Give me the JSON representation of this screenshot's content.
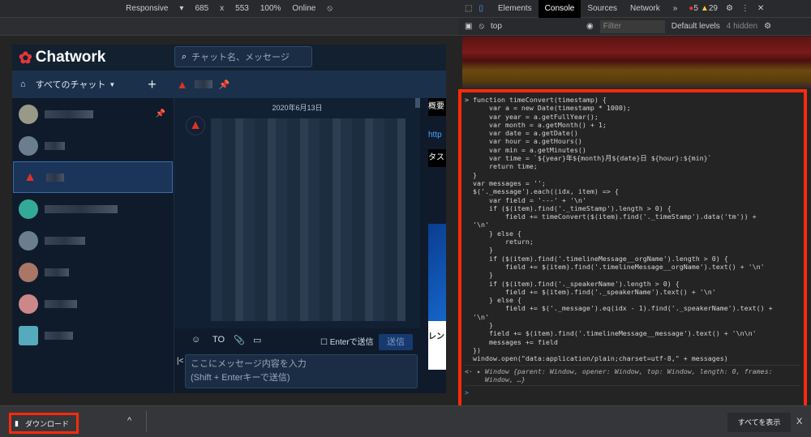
{
  "device_toolbar": {
    "device": "Responsive",
    "width": "685",
    "x": "x",
    "height": "553",
    "zoom": "100%",
    "network": "Online"
  },
  "devtools": {
    "tabs": [
      "Elements",
      "Console",
      "Sources",
      "Network",
      "»"
    ],
    "errors": "5",
    "warnings": "29",
    "context": "top",
    "filter_placeholder": "Filter",
    "levels": "Default levels",
    "hidden": "4 hidden"
  },
  "chatwork": {
    "brand": "Chatwork",
    "search_placeholder": "チャット名、メッセージ",
    "all_chats": "すべてのチャット",
    "date": "2020年6月13日",
    "to_label": "TO",
    "enter_send": "Enterで送信",
    "send": "送信",
    "input_placeholder_1": "ここにメッセージ内容を入力",
    "input_placeholder_2": "(Shift + Enterキーで送信)",
    "right_panel": [
      "概要",
      "http",
      "タス",
      "レン"
    ]
  },
  "console": {
    "code": "> function timeConvert(timestamp) {\n      var a = new Date(timestamp * 1000);\n      var year = a.getFullYear();\n      var month = a.getMonth() + 1;\n      var date = a.getDate()\n      var hour = a.getHours()\n      var min = a.getMinutes()\n      var time = `${year}年${month}月${date}日 ${hour}:${min}`\n      return time;\n  }\n  var messages = '';\n  $('._message').each((idx, item) => {\n      var field = '---' + '\\n'\n      if ($(item).find('._timeStamp').length > 0) {\n          field += timeConvert($(item).find('._timeStamp').data('tm')) +\n  '\\n'\n      } else {\n          return;\n      }\n      if ($(item).find('.timelineMessage__orgName').length > 0) {\n          field += $(item).find('.timelineMessage__orgName').text() + '\\n'\n      }\n      if ($(item).find('._speakerName').length > 0) {\n          field += $(item).find('._speakerName').text() + '\\n'\n      } else {\n          field += $('._message').eq(idx - 1).find('._speakerName').text() +\n  '\\n'\n      }\n      field += $(item).find('.timelineMessage__message').text() + '\\n\\n'\n      messages += field\n  })\n  window.open(\"data:application/plain;charset=utf-8,\" + messages)",
    "result": "<· ▸ Window {parent: Window, opener: Window, top: Window, length: 0, frames:\n     Window, …}",
    "prompt": ">"
  },
  "download_bar": {
    "item": "ダウンロード",
    "show_all": "すべてを表示",
    "close": "X",
    "chevron": "^"
  }
}
